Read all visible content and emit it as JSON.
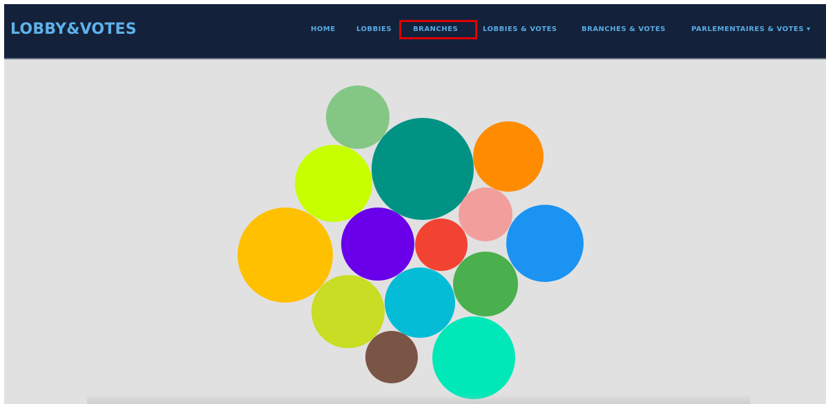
{
  "header": {
    "brand": "LOBBY&VOTES",
    "nav": {
      "home": "HOME",
      "lobbies": "LOBBIES",
      "branches": "BRANCHES",
      "lobbies_votes": "LOBBIES & VOTES",
      "branches_votes": "BRANCHES & VOTES",
      "parlementaires_votes": "PARLEMENTAIRES & VOTES",
      "dropdown_glyph": "▾"
    },
    "active_item": "BRANCHES",
    "colors": {
      "background": "#13223a",
      "link": "#58aae4",
      "highlight": "#e00000"
    }
  },
  "bubble_chart": {
    "background": "#e1e1e1",
    "bubble_colors": [
      "#84c784",
      "#009383",
      "#ff8c00",
      "#c8ff00",
      "#f19e9d",
      "#ffc000",
      "#6a00ea",
      "#f24332",
      "#1b93f2",
      "#c8dd23",
      "#04bcd6",
      "#4aaf4d",
      "#7a5445",
      "#00e8b8"
    ]
  }
}
